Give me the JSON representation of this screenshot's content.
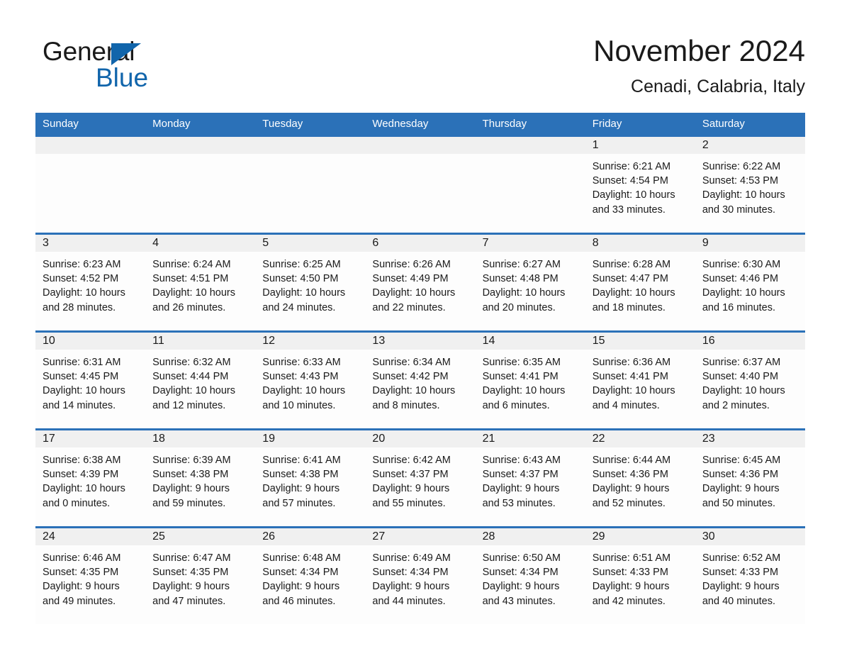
{
  "logo": {
    "part1": "General",
    "part2": "Blue",
    "color_black": "#1a1a1a",
    "color_blue": "#1165ab"
  },
  "header": {
    "title": "November 2024",
    "location": "Cenadi, Calabria, Italy"
  },
  "theme": {
    "header_blue": "#2b71b8",
    "daynum_band": "#f0f0f0",
    "cell_bg": "#fdfdfd",
    "text": "#1a1a1a"
  },
  "weekdays": [
    "Sunday",
    "Monday",
    "Tuesday",
    "Wednesday",
    "Thursday",
    "Friday",
    "Saturday"
  ],
  "weeks": [
    [
      {
        "day": "",
        "sunrise": "",
        "sunset": "",
        "daylight1": "",
        "daylight2": ""
      },
      {
        "day": "",
        "sunrise": "",
        "sunset": "",
        "daylight1": "",
        "daylight2": ""
      },
      {
        "day": "",
        "sunrise": "",
        "sunset": "",
        "daylight1": "",
        "daylight2": ""
      },
      {
        "day": "",
        "sunrise": "",
        "sunset": "",
        "daylight1": "",
        "daylight2": ""
      },
      {
        "day": "",
        "sunrise": "",
        "sunset": "",
        "daylight1": "",
        "daylight2": ""
      },
      {
        "day": "1",
        "sunrise": "Sunrise: 6:21 AM",
        "sunset": "Sunset: 4:54 PM",
        "daylight1": "Daylight: 10 hours",
        "daylight2": "and 33 minutes."
      },
      {
        "day": "2",
        "sunrise": "Sunrise: 6:22 AM",
        "sunset": "Sunset: 4:53 PM",
        "daylight1": "Daylight: 10 hours",
        "daylight2": "and 30 minutes."
      }
    ],
    [
      {
        "day": "3",
        "sunrise": "Sunrise: 6:23 AM",
        "sunset": "Sunset: 4:52 PM",
        "daylight1": "Daylight: 10 hours",
        "daylight2": "and 28 minutes."
      },
      {
        "day": "4",
        "sunrise": "Sunrise: 6:24 AM",
        "sunset": "Sunset: 4:51 PM",
        "daylight1": "Daylight: 10 hours",
        "daylight2": "and 26 minutes."
      },
      {
        "day": "5",
        "sunrise": "Sunrise: 6:25 AM",
        "sunset": "Sunset: 4:50 PM",
        "daylight1": "Daylight: 10 hours",
        "daylight2": "and 24 minutes."
      },
      {
        "day": "6",
        "sunrise": "Sunrise: 6:26 AM",
        "sunset": "Sunset: 4:49 PM",
        "daylight1": "Daylight: 10 hours",
        "daylight2": "and 22 minutes."
      },
      {
        "day": "7",
        "sunrise": "Sunrise: 6:27 AM",
        "sunset": "Sunset: 4:48 PM",
        "daylight1": "Daylight: 10 hours",
        "daylight2": "and 20 minutes."
      },
      {
        "day": "8",
        "sunrise": "Sunrise: 6:28 AM",
        "sunset": "Sunset: 4:47 PM",
        "daylight1": "Daylight: 10 hours",
        "daylight2": "and 18 minutes."
      },
      {
        "day": "9",
        "sunrise": "Sunrise: 6:30 AM",
        "sunset": "Sunset: 4:46 PM",
        "daylight1": "Daylight: 10 hours",
        "daylight2": "and 16 minutes."
      }
    ],
    [
      {
        "day": "10",
        "sunrise": "Sunrise: 6:31 AM",
        "sunset": "Sunset: 4:45 PM",
        "daylight1": "Daylight: 10 hours",
        "daylight2": "and 14 minutes."
      },
      {
        "day": "11",
        "sunrise": "Sunrise: 6:32 AM",
        "sunset": "Sunset: 4:44 PM",
        "daylight1": "Daylight: 10 hours",
        "daylight2": "and 12 minutes."
      },
      {
        "day": "12",
        "sunrise": "Sunrise: 6:33 AM",
        "sunset": "Sunset: 4:43 PM",
        "daylight1": "Daylight: 10 hours",
        "daylight2": "and 10 minutes."
      },
      {
        "day": "13",
        "sunrise": "Sunrise: 6:34 AM",
        "sunset": "Sunset: 4:42 PM",
        "daylight1": "Daylight: 10 hours",
        "daylight2": "and 8 minutes."
      },
      {
        "day": "14",
        "sunrise": "Sunrise: 6:35 AM",
        "sunset": "Sunset: 4:41 PM",
        "daylight1": "Daylight: 10 hours",
        "daylight2": "and 6 minutes."
      },
      {
        "day": "15",
        "sunrise": "Sunrise: 6:36 AM",
        "sunset": "Sunset: 4:41 PM",
        "daylight1": "Daylight: 10 hours",
        "daylight2": "and 4 minutes."
      },
      {
        "day": "16",
        "sunrise": "Sunrise: 6:37 AM",
        "sunset": "Sunset: 4:40 PM",
        "daylight1": "Daylight: 10 hours",
        "daylight2": "and 2 minutes."
      }
    ],
    [
      {
        "day": "17",
        "sunrise": "Sunrise: 6:38 AM",
        "sunset": "Sunset: 4:39 PM",
        "daylight1": "Daylight: 10 hours",
        "daylight2": "and 0 minutes."
      },
      {
        "day": "18",
        "sunrise": "Sunrise: 6:39 AM",
        "sunset": "Sunset: 4:38 PM",
        "daylight1": "Daylight: 9 hours",
        "daylight2": "and 59 minutes."
      },
      {
        "day": "19",
        "sunrise": "Sunrise: 6:41 AM",
        "sunset": "Sunset: 4:38 PM",
        "daylight1": "Daylight: 9 hours",
        "daylight2": "and 57 minutes."
      },
      {
        "day": "20",
        "sunrise": "Sunrise: 6:42 AM",
        "sunset": "Sunset: 4:37 PM",
        "daylight1": "Daylight: 9 hours",
        "daylight2": "and 55 minutes."
      },
      {
        "day": "21",
        "sunrise": "Sunrise: 6:43 AM",
        "sunset": "Sunset: 4:37 PM",
        "daylight1": "Daylight: 9 hours",
        "daylight2": "and 53 minutes."
      },
      {
        "day": "22",
        "sunrise": "Sunrise: 6:44 AM",
        "sunset": "Sunset: 4:36 PM",
        "daylight1": "Daylight: 9 hours",
        "daylight2": "and 52 minutes."
      },
      {
        "day": "23",
        "sunrise": "Sunrise: 6:45 AM",
        "sunset": "Sunset: 4:36 PM",
        "daylight1": "Daylight: 9 hours",
        "daylight2": "and 50 minutes."
      }
    ],
    [
      {
        "day": "24",
        "sunrise": "Sunrise: 6:46 AM",
        "sunset": "Sunset: 4:35 PM",
        "daylight1": "Daylight: 9 hours",
        "daylight2": "and 49 minutes."
      },
      {
        "day": "25",
        "sunrise": "Sunrise: 6:47 AM",
        "sunset": "Sunset: 4:35 PM",
        "daylight1": "Daylight: 9 hours",
        "daylight2": "and 47 minutes."
      },
      {
        "day": "26",
        "sunrise": "Sunrise: 6:48 AM",
        "sunset": "Sunset: 4:34 PM",
        "daylight1": "Daylight: 9 hours",
        "daylight2": "and 46 minutes."
      },
      {
        "day": "27",
        "sunrise": "Sunrise: 6:49 AM",
        "sunset": "Sunset: 4:34 PM",
        "daylight1": "Daylight: 9 hours",
        "daylight2": "and 44 minutes."
      },
      {
        "day": "28",
        "sunrise": "Sunrise: 6:50 AM",
        "sunset": "Sunset: 4:34 PM",
        "daylight1": "Daylight: 9 hours",
        "daylight2": "and 43 minutes."
      },
      {
        "day": "29",
        "sunrise": "Sunrise: 6:51 AM",
        "sunset": "Sunset: 4:33 PM",
        "daylight1": "Daylight: 9 hours",
        "daylight2": "and 42 minutes."
      },
      {
        "day": "30",
        "sunrise": "Sunrise: 6:52 AM",
        "sunset": "Sunset: 4:33 PM",
        "daylight1": "Daylight: 9 hours",
        "daylight2": "and 40 minutes."
      }
    ]
  ]
}
